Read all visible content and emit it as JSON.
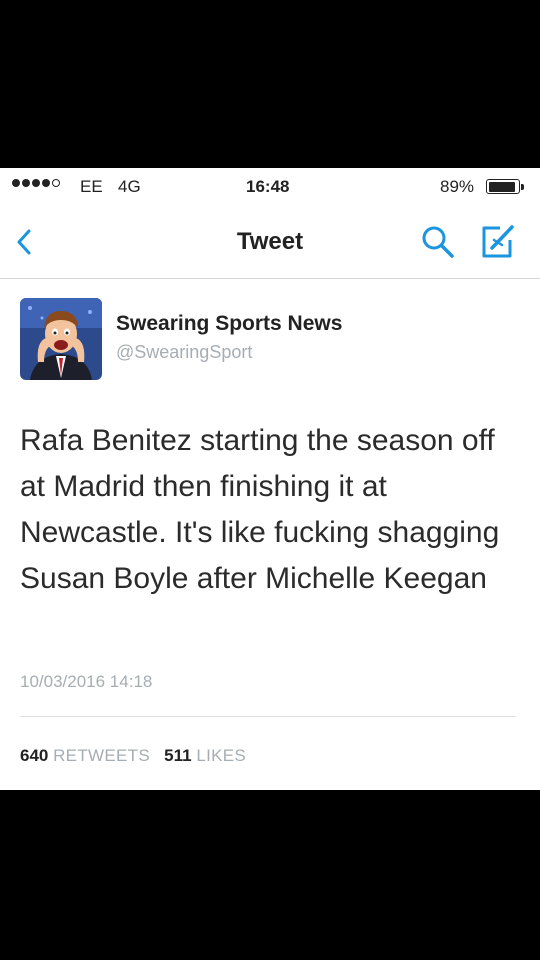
{
  "status_bar": {
    "carrier": "EE",
    "network": "4G",
    "time": "16:48",
    "battery_percent": "89%",
    "battery_level": 0.89,
    "signal_bars_filled": 4,
    "signal_bars_total": 5
  },
  "nav": {
    "title": "Tweet",
    "back_icon": "chevron-left-icon",
    "search_icon": "search-icon",
    "compose_icon": "compose-icon"
  },
  "tweet": {
    "author_name": "Swearing Sports News",
    "author_handle": "@SwearingSport",
    "text": "Rafa Benitez starting the season off at Madrid then finishing it at Newcastle. It's like fucking shagging Susan Boyle after Michelle Keegan",
    "timestamp": "10/03/2016 14:18",
    "retweets_count": "640",
    "retweets_label": "RETWEETS",
    "likes_count": "511",
    "likes_label": "LIKES"
  },
  "colors": {
    "accent": "#1b95e0",
    "muted_text": "#a6adb3",
    "text": "#2b2b2b"
  }
}
